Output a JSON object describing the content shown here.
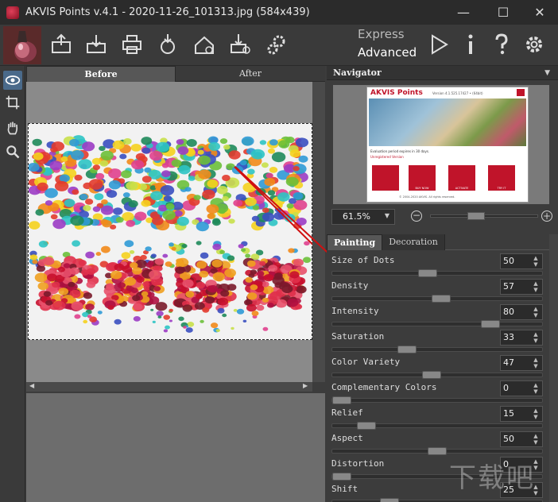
{
  "window": {
    "title": "AKVIS Points v.4.1 - 2020-11-26_101313.jpg (584x439)",
    "minimize_glyph": "—",
    "maximize_glyph": "☐",
    "close_glyph": "✕"
  },
  "toolbar": {
    "mode_express": "Express",
    "mode_advanced": "Advanced",
    "icons": [
      "open-icon",
      "save-icon",
      "print-icon",
      "share-icon",
      "import-icon",
      "export-icon",
      "plugin-settings-icon",
      "run-icon",
      "info-icon",
      "help-icon",
      "preferences-icon"
    ]
  },
  "left_tools": [
    "preview-eye-icon",
    "crop-icon",
    "hand-icon",
    "zoom-icon"
  ],
  "canvas": {
    "tab_before": "Before",
    "tab_after": "After"
  },
  "navigator": {
    "header": "Navigator",
    "zoom": "61.5%",
    "thumb": {
      "brand": "AKVIS Points",
      "version": "Version 4.1.525.17427 • (64bit)",
      "eval_text": "Evaluation period expires in 30 days.",
      "unregistered": "Unregistered Version",
      "buy_now": "BUY NOW",
      "activate": "ACTIVATE",
      "try_it": "TRY IT",
      "copyright": "© 2004-2020 AKVIS. All rights reserved."
    }
  },
  "settings": {
    "tab_painting": "Painting",
    "tab_decoration": "Decoration",
    "params": [
      {
        "label": "Size of Dots",
        "value": "50",
        "fraction": 0.45
      },
      {
        "label": "Density",
        "value": "57",
        "fraction": 0.52
      },
      {
        "label": "Intensity",
        "value": "80",
        "fraction": 0.78
      },
      {
        "label": "Saturation",
        "value": "33",
        "fraction": 0.34
      },
      {
        "label": "Color Variety",
        "value": "47",
        "fraction": 0.47
      },
      {
        "label": "Complementary Colors",
        "value": "0",
        "fraction": 0.0
      },
      {
        "label": "Relief",
        "value": "15",
        "fraction": 0.13
      },
      {
        "label": "Aspect",
        "value": "50",
        "fraction": 0.5
      },
      {
        "label": "Distortion",
        "value": "0",
        "fraction": 0.0
      },
      {
        "label": "Shift",
        "value": "25",
        "fraction": 0.25
      }
    ]
  },
  "watermark": "下载吧"
}
